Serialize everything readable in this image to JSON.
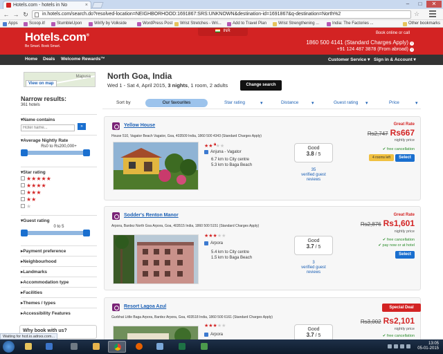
{
  "browser": {
    "tab_title": "Hotels.com - hotels in No",
    "tab_close": "×",
    "url": "in.hotels.com/search.do?resolved-location=NEIGHBORHOOD:1691867:SRS:UNKNOWN&destination-id=1691867&q-destination=North%2",
    "window_controls": {
      "minimize": "–",
      "maximize": "□",
      "close": "✕"
    },
    "nav": {
      "back": "←",
      "forward": "→",
      "reload": "↻"
    },
    "bookmarks": [
      "Apps",
      "Scoop.it!",
      "StumbleUpon",
      "Wirify by Volkside",
      "WordPress Post",
      "Wrist Stretches - Wri...",
      "Add to Travel Plan",
      "Wrist Strengthening ...",
      "India: The Factories ..."
    ],
    "other_bookmarks": "Other bookmarks",
    "status_text": "Waiting for hcd.io.adnxs.com..."
  },
  "header": {
    "logo": "Hotels.com",
    "logo_mark": "®",
    "tagline": "Be Smart. Book Smart.",
    "currency": "INR",
    "book_online": "Book online or call",
    "phone_primary": "1860 500 4141 (Standard Charges Apply)",
    "phone_abroad": "+91 124 487 3878 (From abroad)",
    "info_mark": "i"
  },
  "nav": {
    "items": [
      "Home",
      "Deals",
      "Welcome Rewards™"
    ],
    "right_items": [
      "Customer Service",
      "Sign in & Account"
    ]
  },
  "search": {
    "view_on_map": "View on map",
    "map_label": "Mapusa",
    "destination": "North Goa, India",
    "dates": "Wed 1 - Sat 4, April 2015,",
    "nights": "3 nights",
    "guests": ", 1 room, 2 adults",
    "change_search": "Change search"
  },
  "filters": {
    "title": "Narrow results:",
    "count": "361 hotels",
    "name_contains": "Name contains",
    "name_placeholder": "Hotel name...",
    "go": "»",
    "price_title": "Average Nightly Rate",
    "price_range": "Rs0 to Rs200,000+",
    "price_min_fraction": 0,
    "price_max_fraction": 1,
    "star_title": "Star rating",
    "guest_title": "Guest rating",
    "guest_range": "0 to 5",
    "guest_min_fraction": 0,
    "guest_max_fraction": 1,
    "collapsed": [
      "Payment preference",
      "Neighbourhood",
      "Landmarks",
      "Accommodation type",
      "Facilities",
      "Themes / types",
      "Accessibility Features"
    ],
    "why_book": "Why book with us?"
  },
  "sort": {
    "label": "Sort by",
    "options": [
      "Our favourites",
      "Star rating",
      "Distance",
      "Guest rating",
      "Price"
    ]
  },
  "hotels": [
    {
      "name": "Yellow House",
      "address": "House 510, Vagator Beach Vagator, Goa, 403509 India, 1860 500 4343 (Standard Charges Apply)",
      "stars": 2.5,
      "area": "Anjuna - Vagator",
      "dist1": "6.7 km to City centre",
      "dist2": "5.3 km to Baga Beach",
      "score_label": "Good",
      "score": "3.8",
      "score_max": " / 5",
      "reviews_count": "35",
      "reviews_text1": "verified guest",
      "reviews_text2": "reviews",
      "rate_type": "Great Rate",
      "old_price": "Rs2,747",
      "new_price": "Rs667",
      "nightly": "nightly price",
      "perk1": "✔ free cancellation",
      "perk2": "",
      "rooms_left": "4 rooms left",
      "select": "Select"
    },
    {
      "name": "Sodder's Renton Manor",
      "address": "Arpora, Bardez North Goa Arpora, Goa, 403515 India, 1860 500 5151 (Standard Charges Apply)",
      "stars": 3,
      "area": "Arpora",
      "dist1": "5.4 km to City centre",
      "dist2": "1.5 km to Baga Beach",
      "score_label": "Good",
      "score": "3.7",
      "score_max": " / 5",
      "reviews_count": "3",
      "reviews_text1": "verified guest",
      "reviews_text2": "reviews",
      "rate_type": "Great Rate",
      "old_price": "Rs2,876",
      "new_price": "Rs1,601",
      "nightly": "nightly price",
      "perk1": "✔ free cancellation",
      "perk2": "✔ pay now or at hotel",
      "rooms_left": "",
      "select": "Select"
    },
    {
      "name": "Resort Lagoa Azul",
      "address": "Gurbhat Little Baga Arpora, Bardez Arpora, Goa, 403518 India, 1860 500 6161 (Standard Charges Apply)",
      "stars": 3,
      "area": "Arpora",
      "score_label": "Good",
      "score": "3.7",
      "score_max": " / 5",
      "special": "Special Deal",
      "old_price": "Rs3,002",
      "new_price": "Rs2,101",
      "nightly": "nightly price",
      "perk1": "✔ free cancellation"
    }
  ],
  "taskbar": {
    "time": "13:05",
    "date": "05-01-2015"
  },
  "colors": {
    "brand_red": "#d32323",
    "link_blue": "#1a5fb4",
    "select_blue": "#1a6fcf"
  }
}
